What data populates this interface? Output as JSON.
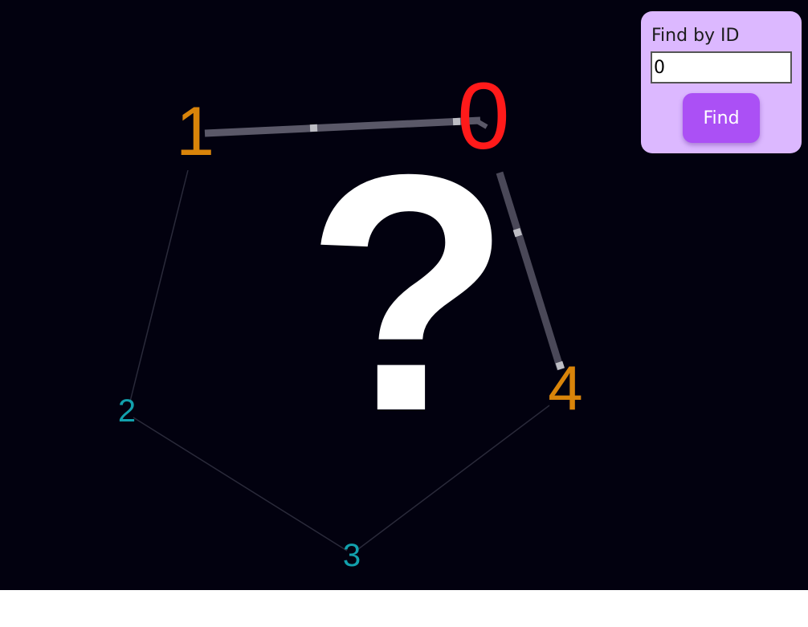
{
  "colors": {
    "background": "#02010f",
    "panel_background": "#dcb8ff",
    "button_background": "#ab50f5",
    "selected_node": "#ff1a1a",
    "neighbor_node": "#d9840a",
    "other_node": "#12a0ac",
    "highlight_edge": "#5a5868",
    "faint_edge": "#2a2a3a",
    "question_mark": "#ffffff"
  },
  "graph": {
    "nodes": [
      {
        "id": "0",
        "state": "selected"
      },
      {
        "id": "1",
        "state": "neighbor"
      },
      {
        "id": "2",
        "state": "other"
      },
      {
        "id": "3",
        "state": "other"
      },
      {
        "id": "4",
        "state": "neighbor"
      }
    ],
    "edges": [
      {
        "from": "1",
        "to": "0",
        "highlighted": true
      },
      {
        "from": "0",
        "to": "4",
        "highlighted": true
      },
      {
        "from": "1",
        "to": "2",
        "highlighted": false
      },
      {
        "from": "2",
        "to": "3",
        "highlighted": false
      },
      {
        "from": "3",
        "to": "4",
        "highlighted": false
      }
    ]
  },
  "overlay": {
    "glyph": "?",
    "icon": "question-mark-icon"
  },
  "find_panel": {
    "label": "Find by ID",
    "input_value": "0",
    "button_label": "Find"
  }
}
